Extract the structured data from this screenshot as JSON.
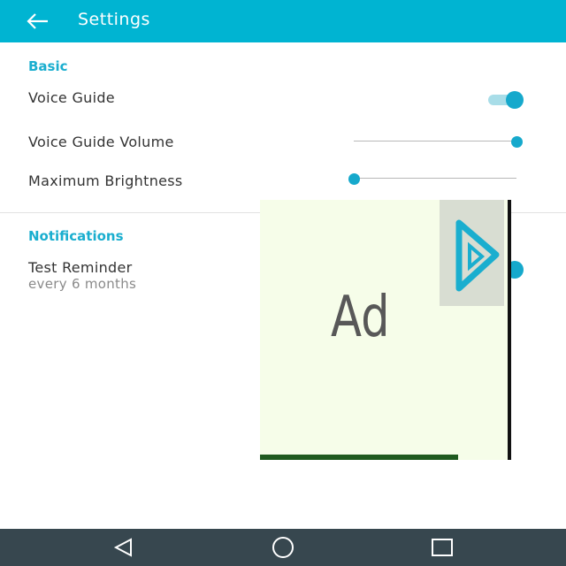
{
  "appbar": {
    "title": "Settings",
    "back_icon": "arrow-left-icon",
    "color": "#00b4d2"
  },
  "basic": {
    "header": "Basic",
    "voice_guide": {
      "label": "Voice Guide",
      "enabled": true
    },
    "voice_guide_volume": {
      "label": "Voice Guide Volume",
      "level": 1.0
    },
    "maximum_brightness": {
      "label": "Maximum Brightness",
      "level": 0.0
    }
  },
  "notifications": {
    "header": "Notifications",
    "test_reminder": {
      "label": "Test Reminder",
      "subtitle": "every 6 months",
      "enabled": true
    }
  },
  "ad": {
    "text": "Ad",
    "icon": "adchoices-play-icon"
  },
  "navbar": {
    "back_icon": "triangle-back-icon",
    "home_icon": "circle-home-icon",
    "recents_icon": "square-recents-icon",
    "color": "#37474f"
  },
  "accent": "#16a9cc"
}
